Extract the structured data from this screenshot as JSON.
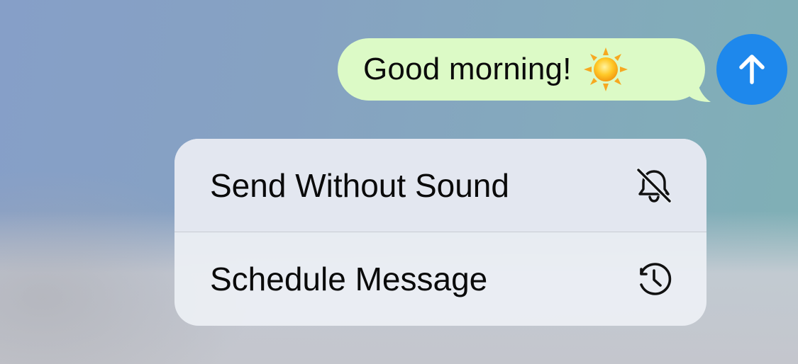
{
  "message": {
    "text": "Good morning!",
    "emoji_icon": "sun-emoji-icon",
    "bubble_color": "#dcfac6"
  },
  "send_button": {
    "icon": "arrow-up-icon",
    "color": "#1e88ec"
  },
  "menu": {
    "items": [
      {
        "label": "Send Without Sound",
        "icon": "bell-slash-icon"
      },
      {
        "label": "Schedule Message",
        "icon": "clock-icon"
      }
    ]
  }
}
